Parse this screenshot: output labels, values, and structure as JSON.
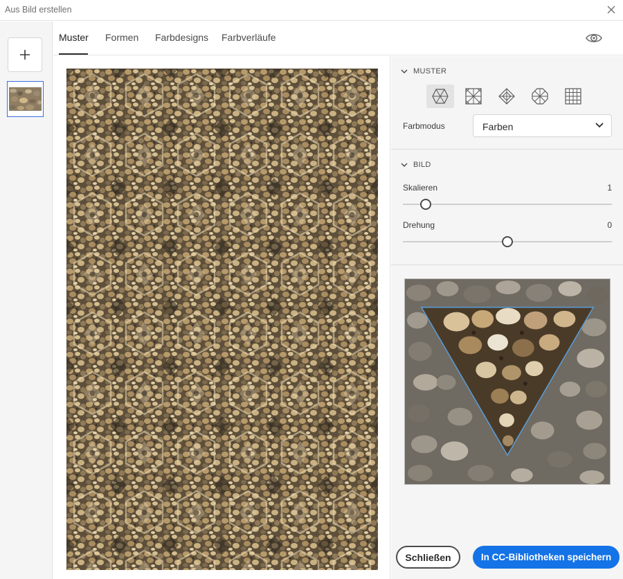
{
  "window": {
    "title": "Aus Bild erstellen",
    "close_icon": "close-icon"
  },
  "sidebar": {
    "add_icon": "plus-icon"
  },
  "tabs": [
    {
      "label": "Muster",
      "active": true
    },
    {
      "label": "Formen",
      "active": false
    },
    {
      "label": "Farbdesigns",
      "active": false
    },
    {
      "label": "Farbverläufe",
      "active": false
    }
  ],
  "toolbar": {
    "preview_icon": "eye-icon"
  },
  "panel": {
    "muster": {
      "heading": "MUSTER",
      "shapes": [
        {
          "icon": "hexagon-pattern-icon",
          "selected": true
        },
        {
          "icon": "square-kaleidoscope-pattern-icon",
          "selected": false
        },
        {
          "icon": "diamond-pattern-icon",
          "selected": false
        },
        {
          "icon": "octagon-pattern-icon",
          "selected": false
        },
        {
          "icon": "grid-pattern-icon",
          "selected": false
        }
      ],
      "farbmodus_label": "Farbmodus",
      "farbmodus_value": "Farben"
    },
    "bild": {
      "heading": "BILD",
      "skalieren_label": "Skalieren",
      "skalieren_value": "1",
      "skalieren_level": 0.11,
      "drehung_label": "Drehung",
      "drehung_value": "0",
      "drehung_level": 0.5
    }
  },
  "buttons": {
    "close_label": "Schließen",
    "save_label": "In CC-Bibliotheken speichern"
  },
  "colors": {
    "accent": "#1473e6",
    "selection_border": "#3b6ee0",
    "triangle_overlay": "#5b9bd5",
    "pebble_tan": "#b79a6a",
    "pebble_dark": "#3a3226"
  }
}
